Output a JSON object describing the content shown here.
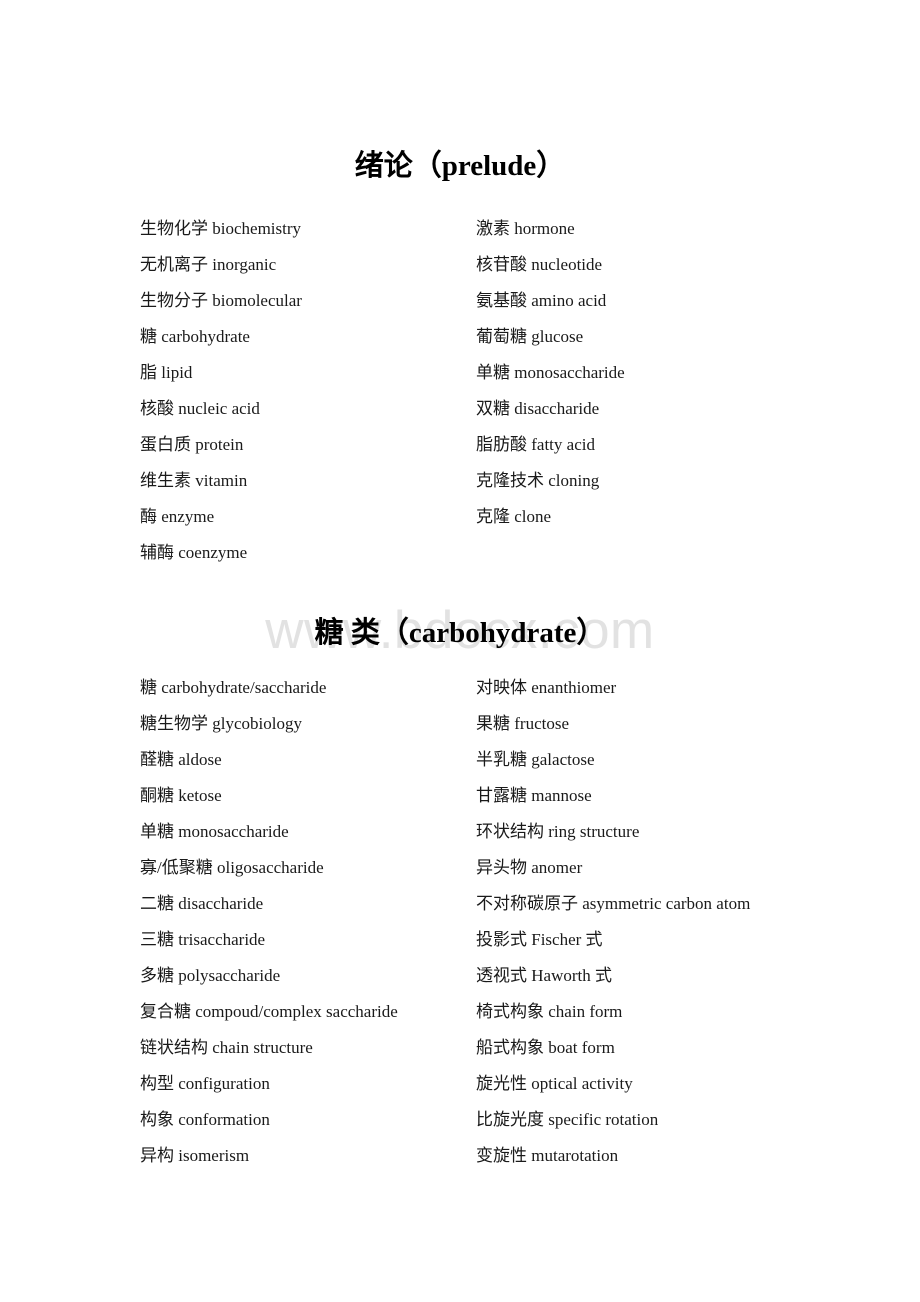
{
  "watermark": {
    "text": "www.bdocx.com",
    "color": "#e2e2e2"
  },
  "document": {
    "background_color": "#ffffff",
    "text_color": "#000000"
  },
  "sections": [
    {
      "heading": "绪论（prelude）",
      "left_column": [
        "生物化学 biochemistry",
        "无机离子 inorganic",
        "生物分子 biomolecular",
        "糖 carbohydrate",
        "脂 lipid",
        "核酸 nucleic acid",
        "蛋白质 protein",
        "维生素 vitamin",
        "酶 enzyme",
        "辅酶 coenzyme"
      ],
      "right_column": [
        "激素 hormone",
        "核苷酸 nucleotide",
        "氨基酸 amino acid",
        "葡萄糖 glucose",
        "单糖 monosaccharide",
        "双糖 disaccharide",
        "脂肪酸 fatty acid",
        "克隆技术 cloning",
        "克隆 clone"
      ]
    },
    {
      "heading": "糖 类（carbohydrate）",
      "left_column": [
        "糖 carbohydrate/saccharide",
        "糖生物学 glycobiology",
        "醛糖 aldose",
        "酮糖 ketose",
        "单糖 monosaccharide",
        "寡/低聚糖 oligosaccharide",
        "二糖 disaccharide",
        "三糖 trisaccharide",
        "多糖 polysaccharide",
        "复合糖 compoud/complex saccharide",
        "链状结构 chain structure",
        "构型 configuration",
        "构象 conformation",
        "异构 isomerism"
      ],
      "right_column": [
        "对映体 enanthiomer",
        "果糖 fructose",
        "半乳糖 galactose",
        "甘露糖 mannose",
        "环状结构 ring structure",
        "异头物 anomer",
        "不对称碳原子 asymmetric carbon atom",
        "投影式 Fischer 式",
        "透视式 Haworth 式",
        "椅式构象 chain form",
        "船式构象 boat form",
        "旋光性 optical activity",
        "比旋光度 specific rotation",
        "变旋性 mutarotation"
      ]
    }
  ]
}
